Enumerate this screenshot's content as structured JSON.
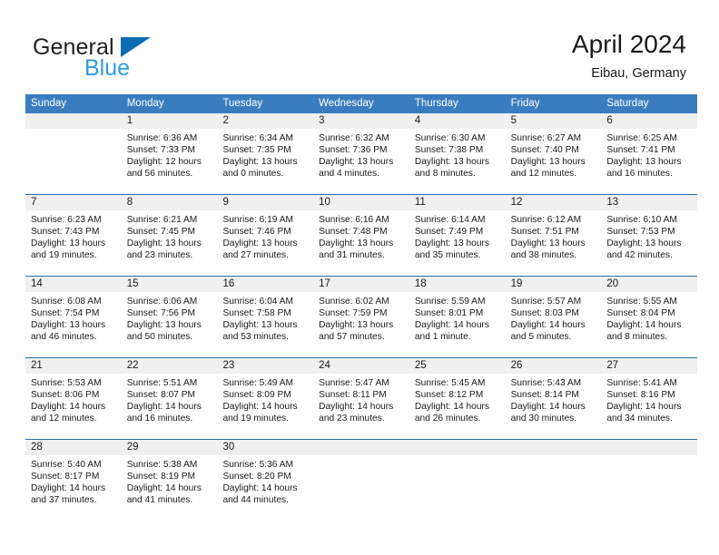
{
  "brand": {
    "line1": "General",
    "line2": "Blue",
    "triangle_color": "#0b6cb2",
    "blue_color": "#2e9be0"
  },
  "header": {
    "title": "April 2024",
    "location": "Eibau, Germany"
  },
  "theme": {
    "header_blue": "#3a7dbf",
    "rule_blue": "#2f6ea8",
    "day_band_gray": "#f0f0f0"
  },
  "weekday_headers": [
    "Sunday",
    "Monday",
    "Tuesday",
    "Wednesday",
    "Thursday",
    "Friday",
    "Saturday"
  ],
  "labels": {
    "sunrise_prefix": "Sunrise:",
    "sunset_prefix": "Sunset:",
    "daylight_prefix": "Daylight:"
  },
  "weeks": [
    [
      {
        "day": "",
        "sunrise": "",
        "sunset": "",
        "daylight_line1": "",
        "daylight_line2": ""
      },
      {
        "day": "1",
        "sunrise": "Sunrise: 6:36 AM",
        "sunset": "Sunset: 7:33 PM",
        "daylight_line1": "Daylight: 12 hours",
        "daylight_line2": "and 56 minutes."
      },
      {
        "day": "2",
        "sunrise": "Sunrise: 6:34 AM",
        "sunset": "Sunset: 7:35 PM",
        "daylight_line1": "Daylight: 13 hours",
        "daylight_line2": "and 0 minutes."
      },
      {
        "day": "3",
        "sunrise": "Sunrise: 6:32 AM",
        "sunset": "Sunset: 7:36 PM",
        "daylight_line1": "Daylight: 13 hours",
        "daylight_line2": "and 4 minutes."
      },
      {
        "day": "4",
        "sunrise": "Sunrise: 6:30 AM",
        "sunset": "Sunset: 7:38 PM",
        "daylight_line1": "Daylight: 13 hours",
        "daylight_line2": "and 8 minutes."
      },
      {
        "day": "5",
        "sunrise": "Sunrise: 6:27 AM",
        "sunset": "Sunset: 7:40 PM",
        "daylight_line1": "Daylight: 13 hours",
        "daylight_line2": "and 12 minutes."
      },
      {
        "day": "6",
        "sunrise": "Sunrise: 6:25 AM",
        "sunset": "Sunset: 7:41 PM",
        "daylight_line1": "Daylight: 13 hours",
        "daylight_line2": "and 16 minutes."
      }
    ],
    [
      {
        "day": "7",
        "sunrise": "Sunrise: 6:23 AM",
        "sunset": "Sunset: 7:43 PM",
        "daylight_line1": "Daylight: 13 hours",
        "daylight_line2": "and 19 minutes."
      },
      {
        "day": "8",
        "sunrise": "Sunrise: 6:21 AM",
        "sunset": "Sunset: 7:45 PM",
        "daylight_line1": "Daylight: 13 hours",
        "daylight_line2": "and 23 minutes."
      },
      {
        "day": "9",
        "sunrise": "Sunrise: 6:19 AM",
        "sunset": "Sunset: 7:46 PM",
        "daylight_line1": "Daylight: 13 hours",
        "daylight_line2": "and 27 minutes."
      },
      {
        "day": "10",
        "sunrise": "Sunrise: 6:16 AM",
        "sunset": "Sunset: 7:48 PM",
        "daylight_line1": "Daylight: 13 hours",
        "daylight_line2": "and 31 minutes."
      },
      {
        "day": "11",
        "sunrise": "Sunrise: 6:14 AM",
        "sunset": "Sunset: 7:49 PM",
        "daylight_line1": "Daylight: 13 hours",
        "daylight_line2": "and 35 minutes."
      },
      {
        "day": "12",
        "sunrise": "Sunrise: 6:12 AM",
        "sunset": "Sunset: 7:51 PM",
        "daylight_line1": "Daylight: 13 hours",
        "daylight_line2": "and 38 minutes."
      },
      {
        "day": "13",
        "sunrise": "Sunrise: 6:10 AM",
        "sunset": "Sunset: 7:53 PM",
        "daylight_line1": "Daylight: 13 hours",
        "daylight_line2": "and 42 minutes."
      }
    ],
    [
      {
        "day": "14",
        "sunrise": "Sunrise: 6:08 AM",
        "sunset": "Sunset: 7:54 PM",
        "daylight_line1": "Daylight: 13 hours",
        "daylight_line2": "and 46 minutes."
      },
      {
        "day": "15",
        "sunrise": "Sunrise: 6:06 AM",
        "sunset": "Sunset: 7:56 PM",
        "daylight_line1": "Daylight: 13 hours",
        "daylight_line2": "and 50 minutes."
      },
      {
        "day": "16",
        "sunrise": "Sunrise: 6:04 AM",
        "sunset": "Sunset: 7:58 PM",
        "daylight_line1": "Daylight: 13 hours",
        "daylight_line2": "and 53 minutes."
      },
      {
        "day": "17",
        "sunrise": "Sunrise: 6:02 AM",
        "sunset": "Sunset: 7:59 PM",
        "daylight_line1": "Daylight: 13 hours",
        "daylight_line2": "and 57 minutes."
      },
      {
        "day": "18",
        "sunrise": "Sunrise: 5:59 AM",
        "sunset": "Sunset: 8:01 PM",
        "daylight_line1": "Daylight: 14 hours",
        "daylight_line2": "and 1 minute."
      },
      {
        "day": "19",
        "sunrise": "Sunrise: 5:57 AM",
        "sunset": "Sunset: 8:03 PM",
        "daylight_line1": "Daylight: 14 hours",
        "daylight_line2": "and 5 minutes."
      },
      {
        "day": "20",
        "sunrise": "Sunrise: 5:55 AM",
        "sunset": "Sunset: 8:04 PM",
        "daylight_line1": "Daylight: 14 hours",
        "daylight_line2": "and 8 minutes."
      }
    ],
    [
      {
        "day": "21",
        "sunrise": "Sunrise: 5:53 AM",
        "sunset": "Sunset: 8:06 PM",
        "daylight_line1": "Daylight: 14 hours",
        "daylight_line2": "and 12 minutes."
      },
      {
        "day": "22",
        "sunrise": "Sunrise: 5:51 AM",
        "sunset": "Sunset: 8:07 PM",
        "daylight_line1": "Daylight: 14 hours",
        "daylight_line2": "and 16 minutes."
      },
      {
        "day": "23",
        "sunrise": "Sunrise: 5:49 AM",
        "sunset": "Sunset: 8:09 PM",
        "daylight_line1": "Daylight: 14 hours",
        "daylight_line2": "and 19 minutes."
      },
      {
        "day": "24",
        "sunrise": "Sunrise: 5:47 AM",
        "sunset": "Sunset: 8:11 PM",
        "daylight_line1": "Daylight: 14 hours",
        "daylight_line2": "and 23 minutes."
      },
      {
        "day": "25",
        "sunrise": "Sunrise: 5:45 AM",
        "sunset": "Sunset: 8:12 PM",
        "daylight_line1": "Daylight: 14 hours",
        "daylight_line2": "and 26 minutes."
      },
      {
        "day": "26",
        "sunrise": "Sunrise: 5:43 AM",
        "sunset": "Sunset: 8:14 PM",
        "daylight_line1": "Daylight: 14 hours",
        "daylight_line2": "and 30 minutes."
      },
      {
        "day": "27",
        "sunrise": "Sunrise: 5:41 AM",
        "sunset": "Sunset: 8:16 PM",
        "daylight_line1": "Daylight: 14 hours",
        "daylight_line2": "and 34 minutes."
      }
    ],
    [
      {
        "day": "28",
        "sunrise": "Sunrise: 5:40 AM",
        "sunset": "Sunset: 8:17 PM",
        "daylight_line1": "Daylight: 14 hours",
        "daylight_line2": "and 37 minutes."
      },
      {
        "day": "29",
        "sunrise": "Sunrise: 5:38 AM",
        "sunset": "Sunset: 8:19 PM",
        "daylight_line1": "Daylight: 14 hours",
        "daylight_line2": "and 41 minutes."
      },
      {
        "day": "30",
        "sunrise": "Sunrise: 5:36 AM",
        "sunset": "Sunset: 8:20 PM",
        "daylight_line1": "Daylight: 14 hours",
        "daylight_line2": "and 44 minutes."
      },
      {
        "day": "",
        "sunrise": "",
        "sunset": "",
        "daylight_line1": "",
        "daylight_line2": ""
      },
      {
        "day": "",
        "sunrise": "",
        "sunset": "",
        "daylight_line1": "",
        "daylight_line2": ""
      },
      {
        "day": "",
        "sunrise": "",
        "sunset": "",
        "daylight_line1": "",
        "daylight_line2": ""
      },
      {
        "day": "",
        "sunrise": "",
        "sunset": "",
        "daylight_line1": "",
        "daylight_line2": ""
      }
    ]
  ]
}
